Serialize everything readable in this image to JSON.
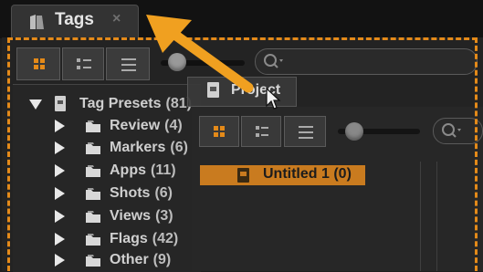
{
  "tab": {
    "title": "Tags",
    "close_glyph": "×",
    "icon": "tags-icon"
  },
  "toolbar": {
    "buttons": [
      "grid-view",
      "list-detail-view",
      "list-view"
    ],
    "search_icon": "search-icon"
  },
  "tree": {
    "root": {
      "label": "Tag Presets",
      "count": "(81)"
    },
    "children": [
      {
        "label": "Review",
        "count": "(4)"
      },
      {
        "label": "Markers",
        "count": "(6)"
      },
      {
        "label": "Apps",
        "count": "(11)"
      },
      {
        "label": "Shots",
        "count": "(6)"
      },
      {
        "label": "Views",
        "count": "(3)"
      },
      {
        "label": "Flags",
        "count": "(42)"
      },
      {
        "label": "Other",
        "count": "(9)"
      }
    ]
  },
  "project_panel": {
    "tab_label": "Project",
    "item": {
      "label": "Untitled 1",
      "count": "(0)"
    }
  },
  "colors": {
    "accent": "#e48a19",
    "selection": "#c97b1f",
    "arrow": "#f0a020"
  }
}
